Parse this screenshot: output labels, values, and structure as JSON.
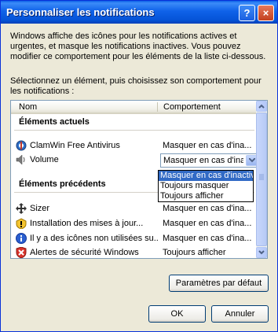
{
  "window": {
    "title": "Personnaliser les notifications",
    "help_glyph": "?",
    "close_glyph": "×"
  },
  "description": "Windows affiche des icônes pour les notifications actives et urgentes, et masque les notifications inactives. Vous pouvez modifier ce comportement pour les éléments de la liste ci-dessous.",
  "instruction": "Sélectionnez un élément, puis choisissez son comportement pour les notifications :",
  "list": {
    "columns": [
      "Nom",
      "Comportement"
    ],
    "sections": [
      {
        "label": "Éléments actuels",
        "items": [
          {
            "name": "ClamWin Free Antivirus",
            "behavior": "Masquer en cas d'ina...",
            "icon": "clamwin-icon"
          },
          {
            "name": "Volume",
            "behavior": "Masquer en cas d'inactivité",
            "icon": "volume-icon",
            "selected": true
          }
        ]
      },
      {
        "label": "Éléments précédents",
        "items": [
          {
            "name": "Sizer",
            "behavior": "Masquer en cas d'ina...",
            "icon": "sizer-icon"
          },
          {
            "name": "Installation des mises à jour...",
            "behavior": "Masquer en cas d'ina...",
            "icon": "windows-update-icon"
          },
          {
            "name": "Il y a des icônes non utilisées su...",
            "behavior": "Masquer en cas d'ina...",
            "icon": "info-icon"
          },
          {
            "name": "Alertes de sécurité Windows",
            "behavior": "Toujours afficher",
            "icon": "security-shield-icon"
          }
        ]
      }
    ]
  },
  "dropdown": {
    "options": [
      "Masquer en cas d'inactivité",
      "Toujours masquer",
      "Toujours afficher"
    ],
    "selected_index": 0
  },
  "buttons": {
    "defaults": "Paramètres par défaut",
    "ok": "OK",
    "cancel": "Annuler"
  },
  "colors": {
    "title_bar": "#0553D6",
    "selection": "#316AC5",
    "dialog_bg": "#ECE9D8"
  }
}
